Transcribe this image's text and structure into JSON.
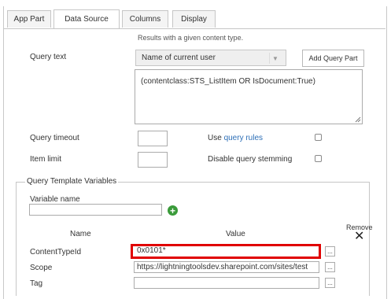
{
  "tabs": [
    "App Part",
    "Data Source",
    "Columns",
    "Display"
  ],
  "active_tab": "Data Source",
  "results_hint": "Results with a given content type.",
  "query_text": {
    "label": "Query text",
    "select_value": "Name of current user",
    "add_button": "Add Query Part",
    "value": "(contentclass:STS_ListItem OR IsDocument:True)"
  },
  "query_timeout": {
    "label": "Query timeout",
    "value": ""
  },
  "item_limit": {
    "label": "Item limit",
    "value": ""
  },
  "use_query_rules": {
    "prefix": "Use ",
    "link": "query rules",
    "checked": false
  },
  "disable_stemming": {
    "label": "Disable query stemming",
    "checked": false
  },
  "template_vars": {
    "legend": "Query Template Variables",
    "variable_name_label": "Variable name",
    "variable_name_value": "",
    "col_name": "Name",
    "col_value": "Value",
    "col_remove": "Remove",
    "rows": [
      {
        "name": "ContentTypeId",
        "value": "0x0101*"
      },
      {
        "name": "Scope",
        "value": "https://lightningtoolsdev.sharepoint.com/sites/test"
      },
      {
        "name": "Tag",
        "value": ""
      }
    ],
    "ellipsis": "..."
  },
  "colors": {
    "link": "#2d6fb7",
    "highlight": "#e00000",
    "add_icon": "#3a9b3a"
  }
}
